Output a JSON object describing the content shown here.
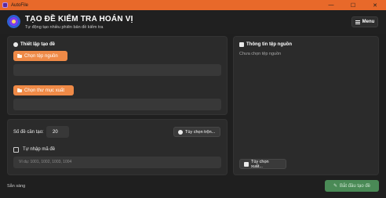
{
  "window": {
    "title": "AutoFile",
    "controls": [
      "—",
      "☐",
      "✕"
    ]
  },
  "header": {
    "title": "TẠO ĐỀ KIỂM TRA HOÁN VỊ",
    "subtitle": "Tự động tạo nhiều phiên bản đề kiểm tra",
    "menu_label": "Menu"
  },
  "settings": {
    "title": "Thiết lập tạo đề",
    "choose_source_label": "Chọn tệp nguồn",
    "choose_output_label": "Chọn thư mục xuất",
    "source_path": "",
    "output_path": ""
  },
  "options": {
    "count_label": "Số đề cần tạo:",
    "count_value": "20",
    "shuffle_options_label": "Tùy chọn trộn...",
    "manual_code_label": "Tự nhập mã đề",
    "manual_code_checked": false,
    "code_placeholder": "Ví dụ: 1001, 1002, 1003, 1004"
  },
  "source_info": {
    "title": "Thông tin tệp nguồn",
    "empty_text": "Chưa chọn tệp nguồn",
    "export_options_label": "Tùy chọn xuất..."
  },
  "footer": {
    "status": "Sẵn sàng",
    "start_label": "Bắt đầu tạo đề"
  },
  "colors": {
    "accent": "#ef8a47",
    "titlebar": "#e8692a",
    "background": "#1f1f1f",
    "panel": "#2b2b2b",
    "start_button": "#4a8a56"
  }
}
